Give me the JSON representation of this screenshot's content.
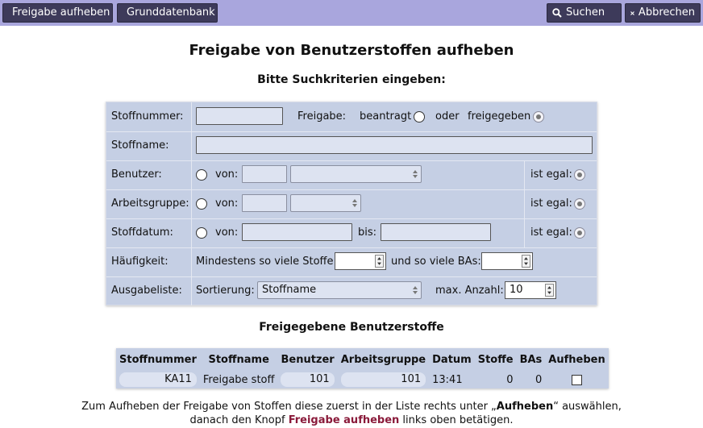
{
  "toolbar": {
    "release_label": "Freigabe aufheben",
    "db_label": "Grunddatenbank",
    "search_label": "Suchen",
    "cancel_label": "Abbrechen"
  },
  "page": {
    "title": "Freigabe von Benutzerstoffen aufheben",
    "criteria_heading": "Bitte Suchkriterien eingeben:"
  },
  "form": {
    "stoffnummer_label": "Stoffnummer:",
    "freigabe_label": "Freigabe:",
    "beantragt_label": "beantragt",
    "oder_label": "oder",
    "freigegeben_label": "freigegeben",
    "stoffname_label": "Stoffname:",
    "benutzer_label": "Benutzer:",
    "arbeitsgruppe_label": "Arbeitsgruppe:",
    "stoffdatum_label": "Stoffdatum:",
    "von_label": "von:",
    "bis_label": "bis:",
    "ist_egal_label": "ist egal:",
    "haeufigkeit_label": "Häufigkeit:",
    "mindestens_label": "Mindestens so viele Stoffe:",
    "und_bas_label": "und so viele BAs:",
    "ausgabeliste_label": "Ausgabeliste:",
    "sortierung_label": "Sortierung:",
    "sortierung_value": "Stoffname",
    "max_anzahl_label": "max. Anzahl:",
    "max_anzahl_value": "10"
  },
  "results": {
    "heading": "Freigegebene Benutzerstoffe",
    "columns": [
      "Stoffnummer",
      "Stoffname",
      "Benutzer",
      "Arbeitsgruppe",
      "Datum",
      "Stoffe",
      "BAs",
      "Aufheben"
    ],
    "rows": [
      {
        "stoffnummer": "KA11",
        "stoffname": "Freigabe stoff",
        "benutzer": "101",
        "arbeitsgruppe": "101",
        "datum": "13:41",
        "stoffe": "0",
        "bas": "0",
        "aufheben": false
      }
    ]
  },
  "footer": {
    "line1_a": "Zum Aufheben der Freigabe von Stoffen diese zuerst in der Liste rechts unter „",
    "line1_b": "Aufheben",
    "line1_c": "“ auswählen,",
    "line2_a": "danach den Knopf ",
    "line2_link": "Freigabe aufheben",
    "line2_c": " links oben betätigen."
  }
}
